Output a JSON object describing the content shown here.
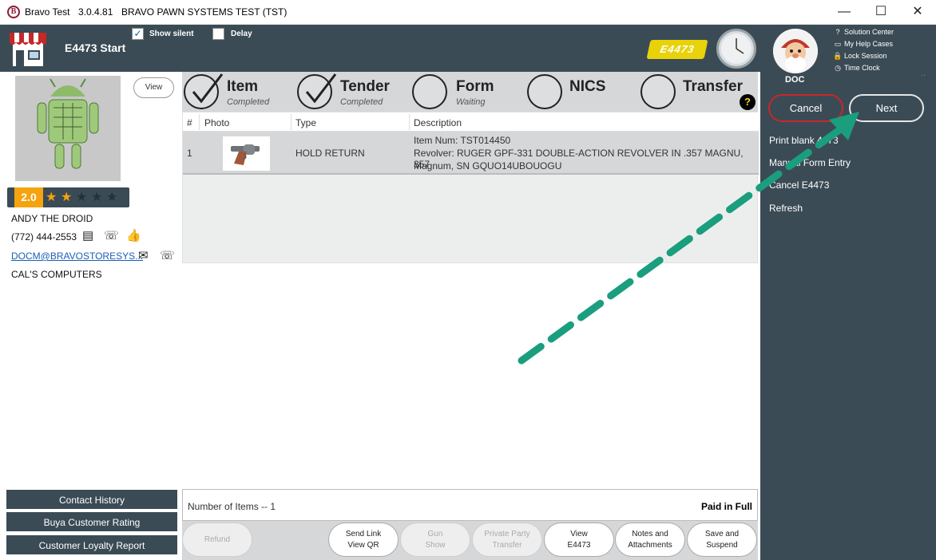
{
  "window": {
    "logo_letter": "B",
    "app_name": "Bravo Test",
    "version": "3.0.4.81",
    "company": "BRAVO PAWN SYSTEMS TEST (TST)",
    "minimize": "—",
    "maximize": "☐",
    "close": "✕"
  },
  "header": {
    "page_title": "E4473 Start",
    "show_silent_label": "Show silent",
    "show_silent_checked": "✓",
    "delay_label": "Delay",
    "badge": "E4473"
  },
  "user": {
    "name": "DOC",
    "links": [
      {
        "icon": "?",
        "label": "Solution Center"
      },
      {
        "icon": "▭",
        "label": "My Help Cases"
      },
      {
        "icon": "🔒",
        "label": "Lock Session"
      },
      {
        "icon": "◷",
        "label": "Time Clock"
      }
    ],
    "status_mark": "··"
  },
  "sidebar": {
    "cancel_label": "Cancel",
    "next_label": "Next",
    "actions": [
      "Print blank 4473",
      "Manual Form Entry",
      "Cancel E4473",
      "Refresh"
    ]
  },
  "customer": {
    "view_label": "View",
    "rating": "2.0",
    "stars_filled": 2,
    "stars_total": 5,
    "name": "ANDY THE DROID",
    "phone": "(772) 444-2553",
    "email": "DOCM@BRAVOSTORESYS...",
    "company": "CAL'S COMPUTERS",
    "buttons": [
      "Contact History",
      "Buya Customer Rating",
      "Customer Loyalty Report"
    ]
  },
  "steps": [
    {
      "name": "Item",
      "status": "Completed",
      "done": true
    },
    {
      "name": "Tender",
      "status": "Completed",
      "done": true
    },
    {
      "name": "Form",
      "status": "Waiting",
      "done": false
    },
    {
      "name": "NICS",
      "status": "",
      "done": false
    },
    {
      "name": "Transfer",
      "status": "",
      "done": false
    }
  ],
  "help_badge": "?",
  "table": {
    "headers": [
      "#",
      "Photo",
      "Type",
      "Description"
    ],
    "rows": [
      {
        "num": "1",
        "type": "HOLD RETURN",
        "desc_line1": "Item Num: TST014450",
        "desc_line2": "Revolver: RUGER GPF-331 DOUBLE-ACTION REVOLVER IN .357 MAGNU, 357",
        "desc_line3": "Magnum, SN GQUO14UBOUOGU"
      }
    ]
  },
  "summary": {
    "items_count": "Number of Items -- 1",
    "paid_status": "Paid in Full"
  },
  "actions": [
    {
      "line1": "Refund",
      "line2": "",
      "enabled": false
    },
    {
      "line1": "Send Link",
      "line2": "View QR",
      "enabled": true
    },
    {
      "line1": "Gun",
      "line2": "Show",
      "enabled": false
    },
    {
      "line1": "Private Party",
      "line2": "Transfer",
      "enabled": false
    },
    {
      "line1": "View",
      "line2": "E4473",
      "enabled": true
    },
    {
      "line1": "Notes and",
      "line2": "Attachments",
      "enabled": true
    },
    {
      "line1": "Save and",
      "line2": "Suspend",
      "enabled": true
    }
  ],
  "colors": {
    "panel": "#3b4b55",
    "cancel_border": "#c62828",
    "rating": "#f5a30e",
    "annotation_arrow": "#1a9e7e"
  }
}
